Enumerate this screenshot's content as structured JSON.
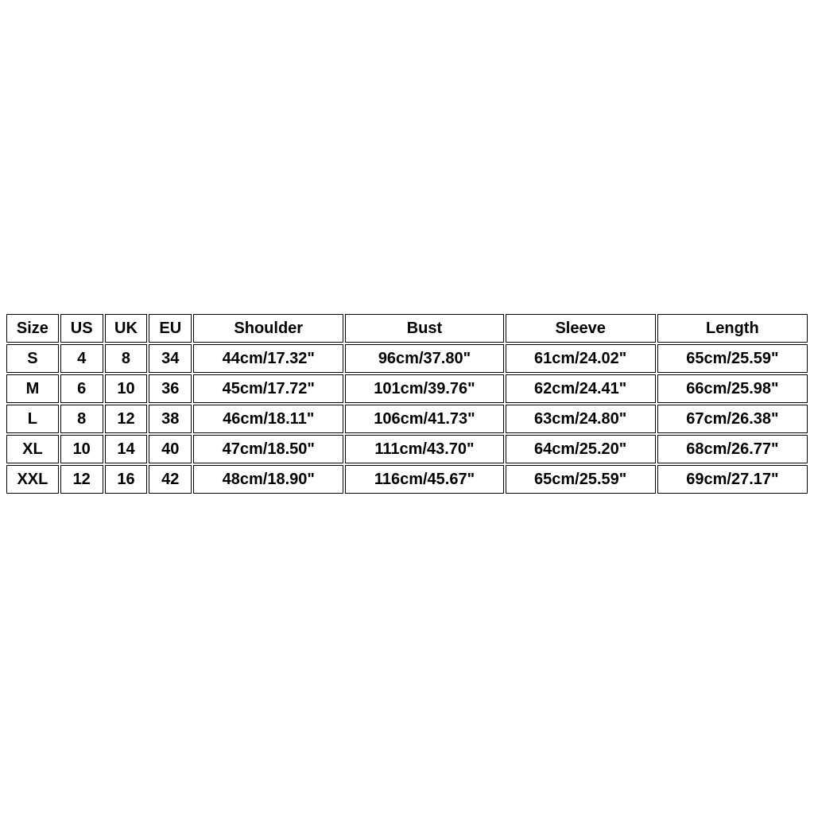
{
  "chart_data": {
    "type": "table",
    "columns": [
      "Size",
      "US",
      "UK",
      "EU",
      "Shoulder",
      "Bust",
      "Sleeve",
      "Length"
    ],
    "rows": [
      [
        "S",
        "4",
        "8",
        "34",
        "44cm/17.32\"",
        "96cm/37.80\"",
        "61cm/24.02\"",
        "65cm/25.59\""
      ],
      [
        "M",
        "6",
        "10",
        "36",
        "45cm/17.72\"",
        "101cm/39.76\"",
        "62cm/24.41\"",
        "66cm/25.98\""
      ],
      [
        "L",
        "8",
        "12",
        "38",
        "46cm/18.11\"",
        "106cm/41.73\"",
        "63cm/24.80\"",
        "67cm/26.38\""
      ],
      [
        "XL",
        "10",
        "14",
        "40",
        "47cm/18.50\"",
        "111cm/43.70\"",
        "64cm/25.20\"",
        "68cm/26.77\""
      ],
      [
        "XXL",
        "12",
        "16",
        "42",
        "48cm/18.90\"",
        "116cm/45.67\"",
        "65cm/25.59\"",
        "69cm/27.17\""
      ]
    ]
  }
}
